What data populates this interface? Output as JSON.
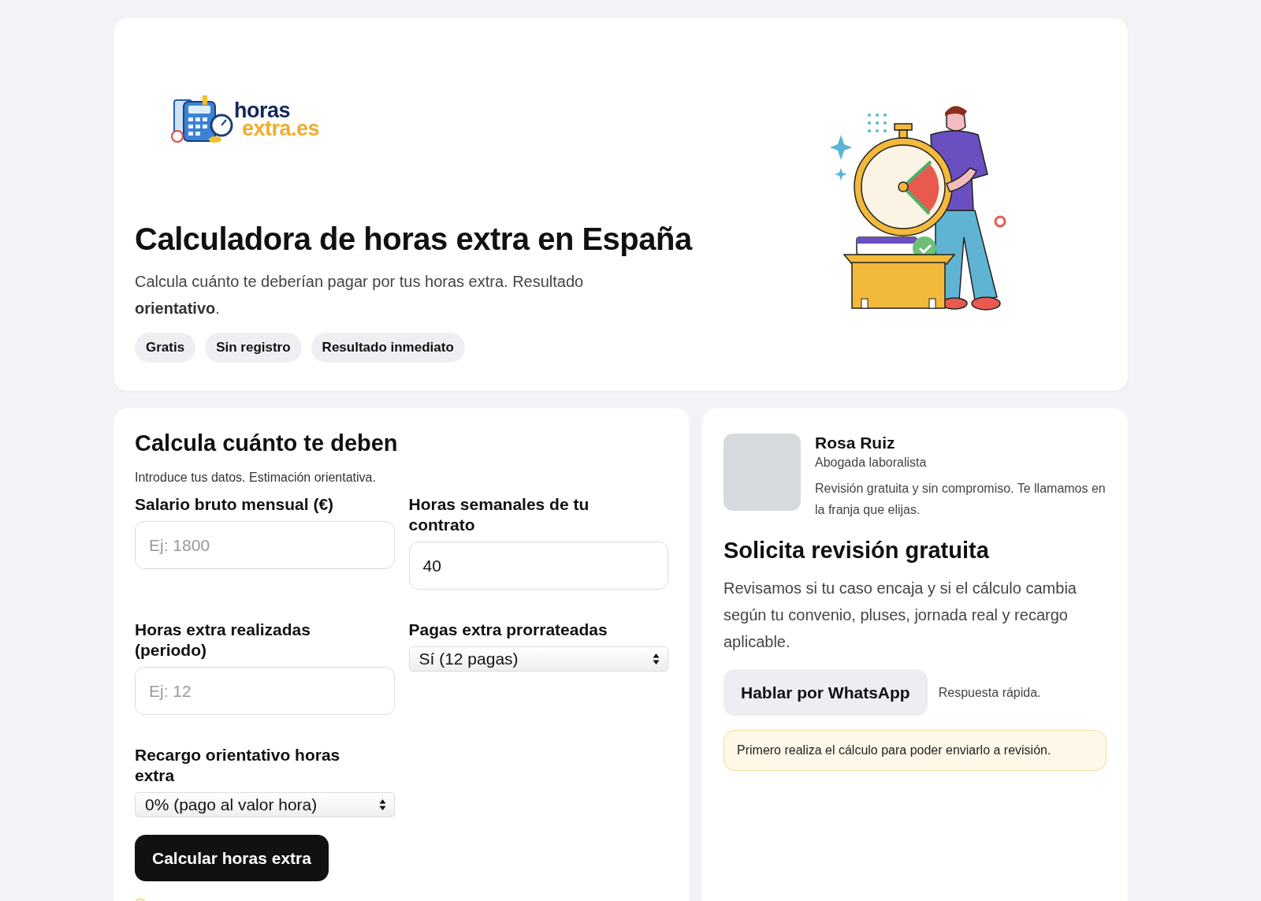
{
  "hero": {
    "logo": {
      "line1": "horas",
      "line2": "extra.es"
    },
    "title": "Calculadora de horas extra en España",
    "subtitle": "Calcula cuánto te deberían pagar por tus horas extra. Resultado **orientativo**.",
    "badges": [
      "Gratis",
      "Sin registro",
      "Resultado inmediato"
    ]
  },
  "calculator": {
    "title": "Calcula cuánto te deben",
    "intro": "Introduce tus datos. Estimación orientativa.",
    "fields": [
      {
        "kind": "input",
        "label": "Salario bruto mensual (€)",
        "placeholder": "Ej: 1800"
      },
      {
        "kind": "input",
        "label": "Horas semanales de tu contrato",
        "value": "40"
      },
      {
        "kind": "input",
        "label": "Horas extra realizadas (periodo)",
        "placeholder": "Ej: 12"
      },
      {
        "kind": "select",
        "label": "Pagas extra prorrateadas",
        "value": "Sí (12 pagas)"
      },
      {
        "kind": "select",
        "label": "Recargo orientativo horas extra",
        "value": "0% (pago al valor hora)"
      }
    ],
    "button": "Calcular horas extra"
  },
  "contact": {
    "name": "Rosa Ruiz",
    "role": "Abogada laboralista",
    "note": "Revisión gratuita y sin compromiso. Te llamamos en la franja que elijas.",
    "heading": "Solicita revisión gratuita",
    "text": "Revisamos si tu caso encaja y si el cálculo cambia según tu convenio, pluses, jornada real y recargo aplicable.",
    "whatsapp_button": "Hablar por WhatsApp",
    "response_note": "Respuesta rápida.",
    "notice": "Primero realiza el cálculo para poder enviarlo a revisión."
  }
}
